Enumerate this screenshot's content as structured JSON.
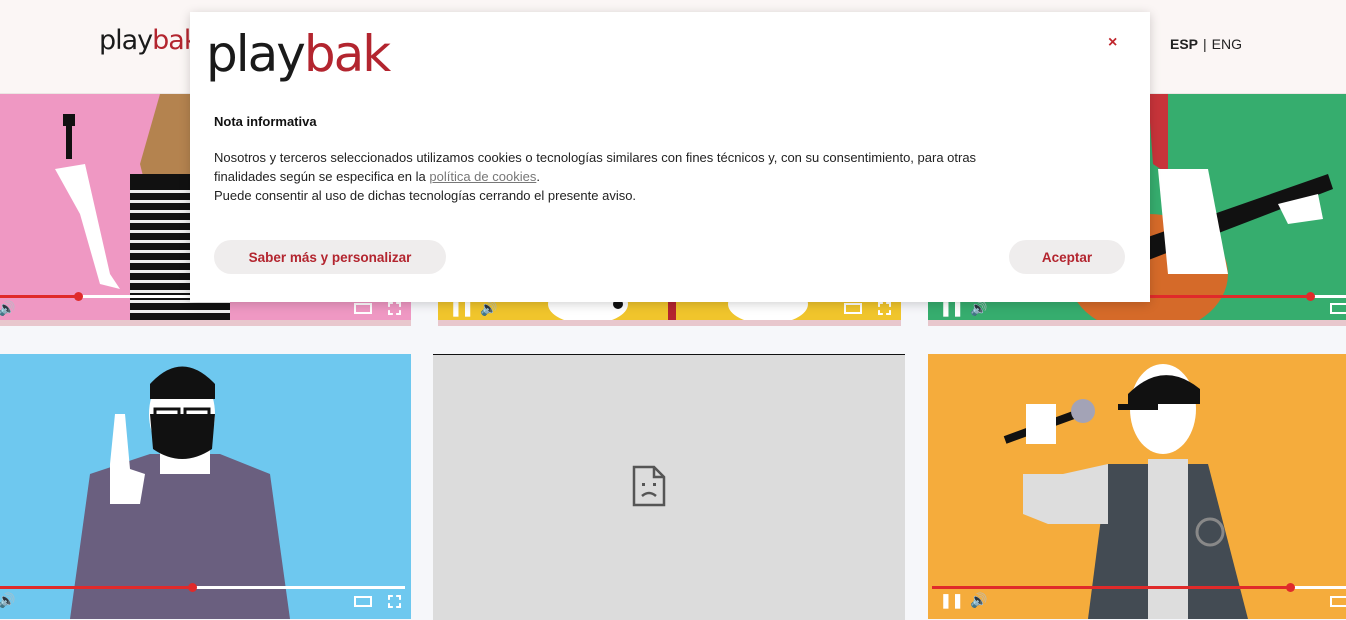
{
  "header": {
    "logo_part1": "play",
    "logo_part2": "bak",
    "lang_esp": "ESP",
    "lang_sep": "|",
    "lang_eng": "ENG"
  },
  "cookie_modal": {
    "logo_part1": "play",
    "logo_part2": "bak",
    "close_label": "×",
    "title": "Nota informativa",
    "text_line1": "Nosotros y terceros seleccionados utilizamos cookies o tecnologías similares con fines técnicos y, con su consentimiento, para otras",
    "text_line2_before": "finalidades según se especifica en la ",
    "text_link": "política de cookies",
    "text_line2_after": ".",
    "text_line3": "Puede consentir al uso de dichas tecnologías cerrando el presente aviso.",
    "button_more": "Saber más y personalizar",
    "button_accept": "Aceptar"
  },
  "videos": {
    "colors": {
      "pink": "#ef98c3",
      "yellow": "#f0c52c",
      "green": "#36ad6e",
      "blue": "#6ec8ef",
      "gray": "#dcdcdc",
      "orange": "#f5ac3c",
      "accent_red": "#e02a2a"
    },
    "tiles": [
      {
        "name": "makeup-artist",
        "progress": 0.19
      },
      {
        "name": "music-performer",
        "progress": null
      },
      {
        "name": "guitarist",
        "progress": 0.92
      },
      {
        "name": "bearded-man",
        "progress": 0.47
      },
      {
        "name": "broken-video",
        "progress": null
      },
      {
        "name": "rapper",
        "progress": 0.87
      }
    ]
  }
}
